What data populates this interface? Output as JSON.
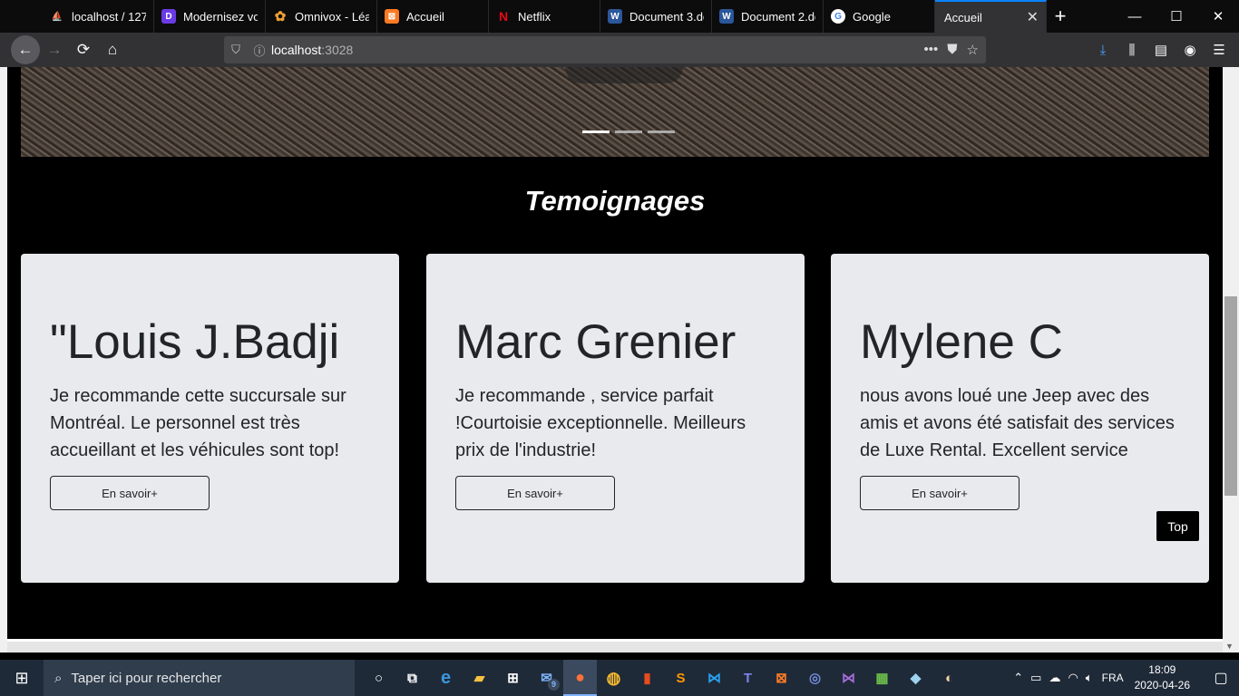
{
  "browser": {
    "tabs": [
      {
        "title": "localhost / 127.",
        "icon": "phpmyadmin-icon",
        "color": "#f29111",
        "glyph": "⛵"
      },
      {
        "title": "Modernisez vo",
        "icon": "d-logo-icon",
        "color": "#6a3be4",
        "glyph": "D"
      },
      {
        "title": "Omnivox - Léa",
        "icon": "flower-icon",
        "color": "#f0a030",
        "glyph": "✿"
      },
      {
        "title": "Accueil",
        "icon": "xampp-icon",
        "color": "#fb7a24",
        "glyph": "⊠"
      },
      {
        "title": "Netflix",
        "icon": "netflix-icon",
        "color": "#e50914",
        "glyph": "N"
      },
      {
        "title": "Document 3.do",
        "icon": "word-icon",
        "color": "#2b579a",
        "glyph": "W"
      },
      {
        "title": "Document 2.do",
        "icon": "word-icon",
        "color": "#2b579a",
        "glyph": "W"
      },
      {
        "title": "Google",
        "icon": "google-icon",
        "color": "#4285f4",
        "glyph": "G"
      },
      {
        "title": "Accueil",
        "icon": "close-icon",
        "color": "#323234",
        "glyph": ""
      }
    ],
    "new_tab": "+",
    "url_host": "localhost",
    "url_port": ":3028",
    "window": {
      "minimize": "—",
      "maximize": "☐",
      "close": "✕"
    }
  },
  "page": {
    "section_title": "Temoignages",
    "cards": [
      {
        "name": "\"Louis J.Badji",
        "text": "Je recommande cette succursale sur Montréal. Le personnel est très accueillant et les véhicules sont top!",
        "button": "En savoir+"
      },
      {
        "name": "Marc Grenier",
        "text": "Je recommande , service parfait !Courtoisie exceptionnelle. Meilleurs prix de l'industrie!",
        "button": "En savoir+"
      },
      {
        "name": "Mylene C",
        "text": "nous avons loué une Jeep avec des amis et avons été satisfait des services de Luxe Rental. Excellent service",
        "button": "En savoir+"
      }
    ],
    "top_button": "Top"
  },
  "taskbar": {
    "search_placeholder": "Taper ici pour rechercher",
    "mail_badge": "9",
    "language": "FRA",
    "time": "18:09",
    "date": "2020-04-26"
  }
}
